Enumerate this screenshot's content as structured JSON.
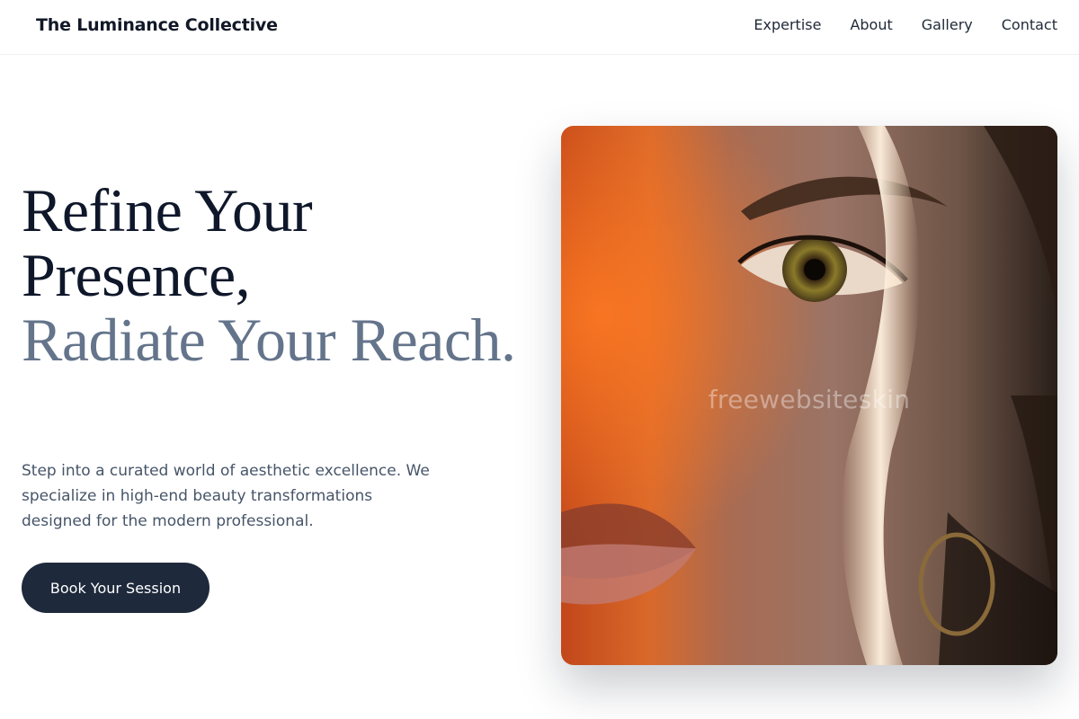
{
  "brand": {
    "name": "The Luminance Collective"
  },
  "nav": {
    "links": [
      "Expertise",
      "About",
      "Gallery",
      "Contact"
    ]
  },
  "hero": {
    "headline_dark": "Refine Your Presence,",
    "headline_light": "Radiate Your Reach.",
    "description": "Step into a curated world of aesthetic excellence. We specialize in high-end beauty transformations designed for the modern professional.",
    "cta_label": "Book Your Session",
    "image_watermark": "freewebsiteskin"
  },
  "colors": {
    "heading_dark": "#0f172a",
    "heading_light": "#64748b",
    "body_text": "#475569",
    "button_bg": "#1e293b",
    "button_text": "#ffffff"
  },
  "icons": {
    "hero_image": "portrait-photo"
  }
}
